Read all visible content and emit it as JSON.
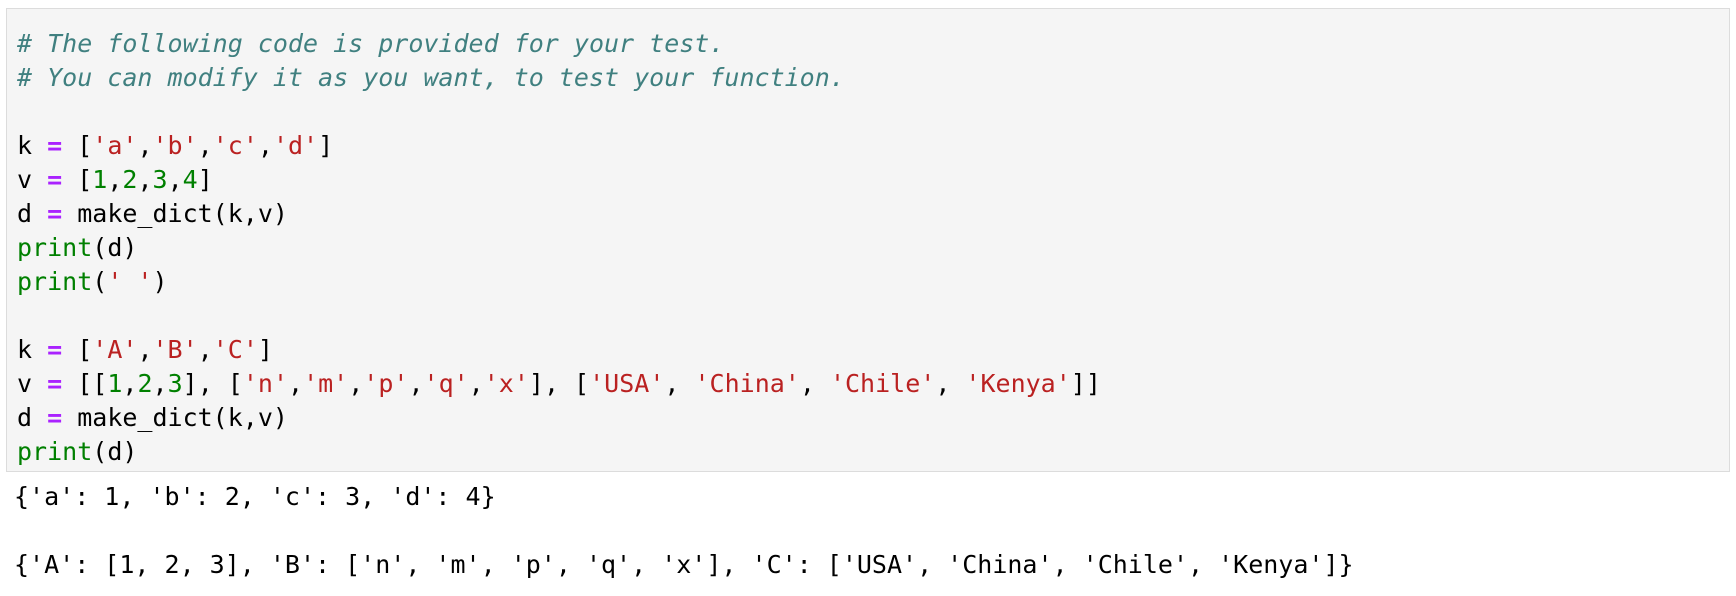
{
  "code_cell": {
    "lines": [
      [
        {
          "t": "# The following code is provided for your test.",
          "c": "comment"
        }
      ],
      [
        {
          "t": "# You can modify it as you want, to test your function.",
          "c": "comment"
        }
      ],
      [],
      [
        {
          "t": "k ",
          "c": "name"
        },
        {
          "t": "=",
          "c": "op"
        },
        {
          "t": " [",
          "c": "punct"
        },
        {
          "t": "'a'",
          "c": "str"
        },
        {
          "t": ",",
          "c": "punct"
        },
        {
          "t": "'b'",
          "c": "str"
        },
        {
          "t": ",",
          "c": "punct"
        },
        {
          "t": "'c'",
          "c": "str"
        },
        {
          "t": ",",
          "c": "punct"
        },
        {
          "t": "'d'",
          "c": "str"
        },
        {
          "t": "]",
          "c": "punct"
        }
      ],
      [
        {
          "t": "v ",
          "c": "name"
        },
        {
          "t": "=",
          "c": "op"
        },
        {
          "t": " [",
          "c": "punct"
        },
        {
          "t": "1",
          "c": "num"
        },
        {
          "t": ",",
          "c": "punct"
        },
        {
          "t": "2",
          "c": "num"
        },
        {
          "t": ",",
          "c": "punct"
        },
        {
          "t": "3",
          "c": "num"
        },
        {
          "t": ",",
          "c": "punct"
        },
        {
          "t": "4",
          "c": "num"
        },
        {
          "t": "]",
          "c": "punct"
        }
      ],
      [
        {
          "t": "d ",
          "c": "name"
        },
        {
          "t": "=",
          "c": "op"
        },
        {
          "t": " make_dict(k,v)",
          "c": "name"
        }
      ],
      [
        {
          "t": "print",
          "c": "builtin"
        },
        {
          "t": "(d)",
          "c": "punct"
        }
      ],
      [
        {
          "t": "print",
          "c": "builtin"
        },
        {
          "t": "(",
          "c": "punct"
        },
        {
          "t": "' '",
          "c": "str"
        },
        {
          "t": ")",
          "c": "punct"
        }
      ],
      [],
      [
        {
          "t": "k ",
          "c": "name"
        },
        {
          "t": "=",
          "c": "op"
        },
        {
          "t": " [",
          "c": "punct"
        },
        {
          "t": "'A'",
          "c": "str"
        },
        {
          "t": ",",
          "c": "punct"
        },
        {
          "t": "'B'",
          "c": "str"
        },
        {
          "t": ",",
          "c": "punct"
        },
        {
          "t": "'C'",
          "c": "str"
        },
        {
          "t": "]",
          "c": "punct"
        }
      ],
      [
        {
          "t": "v ",
          "c": "name"
        },
        {
          "t": "=",
          "c": "op"
        },
        {
          "t": " [[",
          "c": "punct"
        },
        {
          "t": "1",
          "c": "num"
        },
        {
          "t": ",",
          "c": "punct"
        },
        {
          "t": "2",
          "c": "num"
        },
        {
          "t": ",",
          "c": "punct"
        },
        {
          "t": "3",
          "c": "num"
        },
        {
          "t": "], [",
          "c": "punct"
        },
        {
          "t": "'n'",
          "c": "str"
        },
        {
          "t": ",",
          "c": "punct"
        },
        {
          "t": "'m'",
          "c": "str"
        },
        {
          "t": ",",
          "c": "punct"
        },
        {
          "t": "'p'",
          "c": "str"
        },
        {
          "t": ",",
          "c": "punct"
        },
        {
          "t": "'q'",
          "c": "str"
        },
        {
          "t": ",",
          "c": "punct"
        },
        {
          "t": "'x'",
          "c": "str"
        },
        {
          "t": "], [",
          "c": "punct"
        },
        {
          "t": "'USA'",
          "c": "str"
        },
        {
          "t": ", ",
          "c": "punct"
        },
        {
          "t": "'China'",
          "c": "str"
        },
        {
          "t": ", ",
          "c": "punct"
        },
        {
          "t": "'Chile'",
          "c": "str"
        },
        {
          "t": ", ",
          "c": "punct"
        },
        {
          "t": "'Kenya'",
          "c": "str"
        },
        {
          "t": "]]",
          "c": "punct"
        }
      ],
      [
        {
          "t": "d ",
          "c": "name"
        },
        {
          "t": "=",
          "c": "op"
        },
        {
          "t": " make_dict(k,v)",
          "c": "name"
        }
      ],
      [
        {
          "t": "print",
          "c": "builtin"
        },
        {
          "t": "(d)",
          "c": "punct"
        }
      ]
    ]
  },
  "output": {
    "lines": [
      "{'a': 1, 'b': 2, 'c': 3, 'd': 4}",
      " ",
      "{'A': [1, 2, 3], 'B': ['n', 'm', 'p', 'q', 'x'], 'C': ['USA', 'China', 'Chile', 'Kenya']}"
    ]
  },
  "colors": {
    "comment": "#408080",
    "operator": "#aa22ff",
    "string": "#ba2121",
    "number": "#008000",
    "builtin": "#008000",
    "input_background": "#f5f5f5",
    "input_border": "#dcdcdc"
  }
}
